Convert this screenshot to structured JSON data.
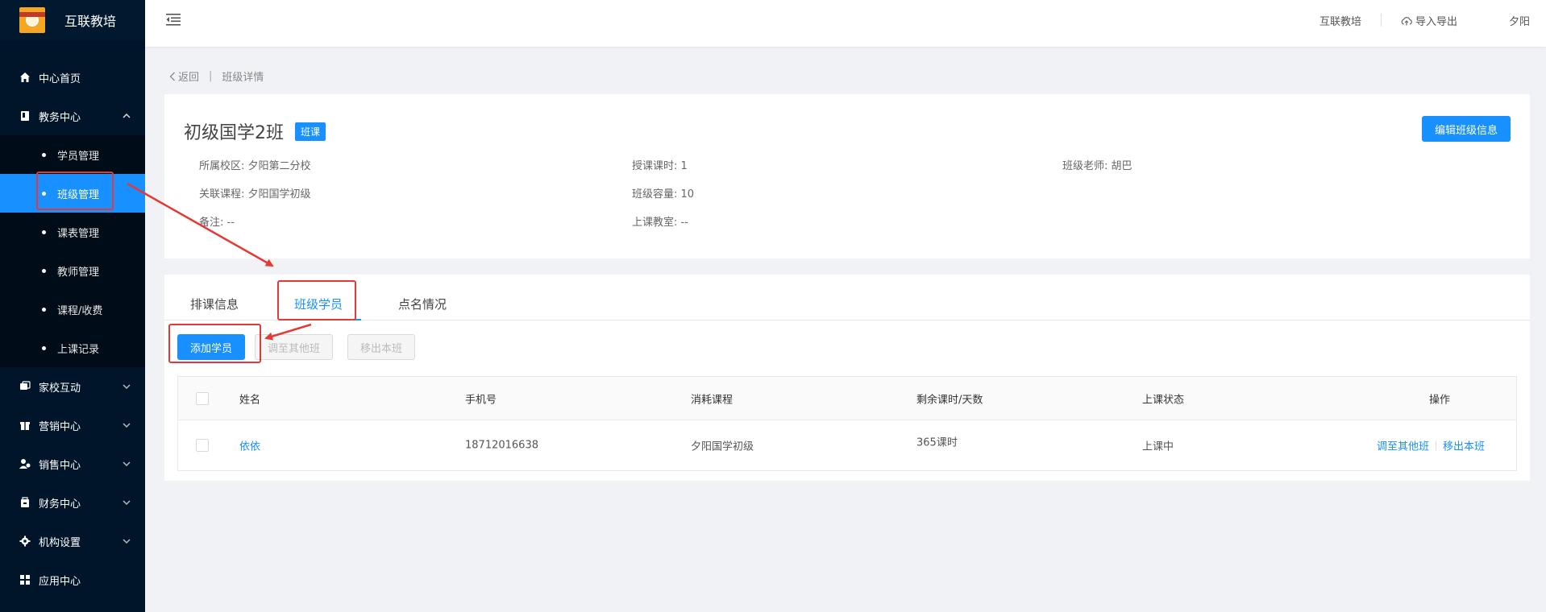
{
  "app": {
    "title": "互联教培"
  },
  "sidebar": {
    "items": [
      {
        "label": "中心首页",
        "icon": "home-icon"
      },
      {
        "label": "教务中心",
        "icon": "book-icon",
        "expanded": true,
        "children": [
          {
            "label": "学员管理"
          },
          {
            "label": "班级管理",
            "active": true
          },
          {
            "label": "课表管理"
          },
          {
            "label": "教师管理"
          },
          {
            "label": "课程/收费"
          },
          {
            "label": "上课记录"
          }
        ]
      },
      {
        "label": "家校互动",
        "icon": "chat-icon"
      },
      {
        "label": "营销中心",
        "icon": "gift-icon"
      },
      {
        "label": "销售中心",
        "icon": "sales-icon"
      },
      {
        "label": "财务中心",
        "icon": "finance-icon"
      },
      {
        "label": "机构设置",
        "icon": "gear-icon"
      },
      {
        "label": "应用中心",
        "icon": "grid-icon"
      }
    ]
  },
  "header": {
    "org": "互联教培",
    "import_export": "导入导出",
    "user": "夕阳"
  },
  "breadcrumb": {
    "back": "返回",
    "current": "班级详情"
  },
  "class_info": {
    "title": "初级国学2班",
    "tag": "班课",
    "edit_button": "编辑班级信息",
    "campus": "所属校区: 夕阳第二分校",
    "course": "关联课程: 夕阳国学初级",
    "remark": "备注: --",
    "lesson_hours": "授课课时: 1",
    "capacity": "班级容量: 10",
    "classroom": "上课教室: --",
    "teacher": "班级老师:  胡巴"
  },
  "tabs": [
    "排课信息",
    "班级学员",
    "点名情况"
  ],
  "actions": {
    "add": "添加学员",
    "transfer": "调至其他班",
    "remove": "移出本班"
  },
  "table": {
    "headers": [
      "姓名",
      "手机号",
      "消耗课程",
      "剩余课时/天数",
      "上课状态",
      "操作"
    ],
    "rows": [
      {
        "name": "依依",
        "phone": "18712016638",
        "course": "夕阳国学初级",
        "remaining": "365课时",
        "status": "上课中",
        "op_transfer": "调至其他班",
        "op_remove": "移出本班"
      }
    ]
  },
  "colors": {
    "primary": "#1890ff",
    "sidebar_bg": "#001529",
    "annotation": "#e53935"
  }
}
